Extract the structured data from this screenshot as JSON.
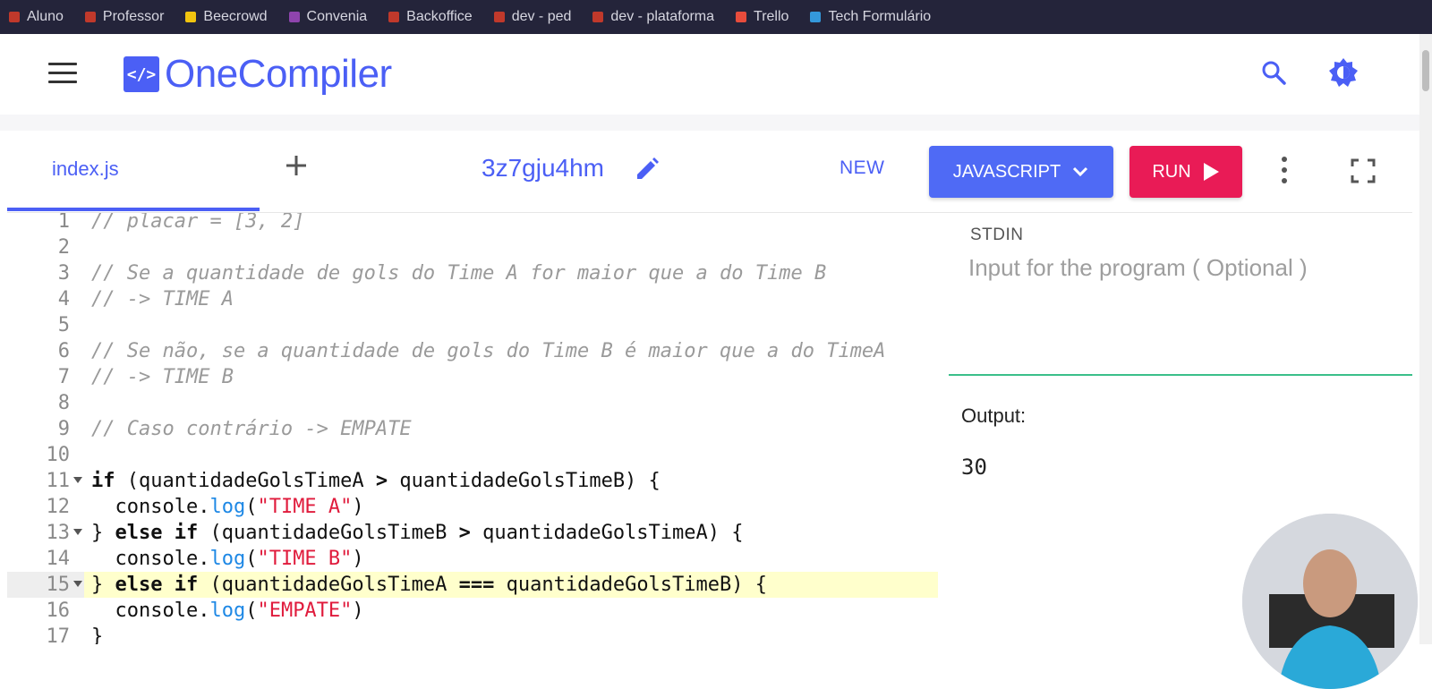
{
  "bookmarks": [
    {
      "label": "Aluno",
      "color": "#c0392b"
    },
    {
      "label": "Professor",
      "color": "#c0392b"
    },
    {
      "label": "Beecrowd",
      "color": "#f1c40f"
    },
    {
      "label": "Convenia",
      "color": "#8e44ad"
    },
    {
      "label": "Backoffice",
      "color": "#c0392b"
    },
    {
      "label": "dev - ped",
      "color": "#c0392b"
    },
    {
      "label": "dev - plataforma",
      "color": "#c0392b"
    },
    {
      "label": "Trello",
      "color": "#e74c3c"
    },
    {
      "label": "Tech Formulário",
      "color": "#3498db"
    }
  ],
  "header": {
    "logo_badge": "</>",
    "logo_text": "OneCompiler",
    "search_icon": "search-icon",
    "theme_icon": "theme-toggle-icon"
  },
  "toolbar": {
    "tab_file": "index.js",
    "title_id": "3z7gju4hm",
    "new_label": "NEW",
    "language_label": "JAVASCRIPT",
    "run_label": "RUN"
  },
  "colors": {
    "accent": "#4b5ff5",
    "run": "#e91b56",
    "divider": "#3bbf8a"
  },
  "editor": {
    "highlighted_line": 15,
    "lines": [
      {
        "n": "1",
        "fold": false,
        "tokens": [
          {
            "t": "// placar = [3, 2]",
            "c": "cm"
          }
        ]
      },
      {
        "n": "2",
        "fold": false,
        "tokens": []
      },
      {
        "n": "3",
        "fold": false,
        "tokens": [
          {
            "t": "// Se a quantidade de gols do Time A for maior que a do Time B",
            "c": "cm"
          }
        ]
      },
      {
        "n": "4",
        "fold": false,
        "tokens": [
          {
            "t": "// -> TIME A",
            "c": "cm"
          }
        ]
      },
      {
        "n": "5",
        "fold": false,
        "tokens": []
      },
      {
        "n": "6",
        "fold": false,
        "tokens": [
          {
            "t": "// Se não, se a quantidade de gols do Time B é maior que a do TimeA",
            "c": "cm"
          }
        ]
      },
      {
        "n": "7",
        "fold": false,
        "tokens": [
          {
            "t": "// -> TIME B",
            "c": "cm"
          }
        ]
      },
      {
        "n": "8",
        "fold": false,
        "tokens": []
      },
      {
        "n": "9",
        "fold": false,
        "tokens": [
          {
            "t": "// Caso contrário -> EMPATE",
            "c": "cm"
          }
        ]
      },
      {
        "n": "10",
        "fold": false,
        "tokens": []
      },
      {
        "n": "11",
        "fold": true,
        "tokens": [
          {
            "t": "if",
            "c": "kw"
          },
          {
            "t": " (quantidadeGolsTimeA ",
            "c": ""
          },
          {
            "t": ">",
            "c": "kw"
          },
          {
            "t": " quantidadeGolsTimeB) {",
            "c": ""
          }
        ]
      },
      {
        "n": "12",
        "fold": false,
        "tokens": [
          {
            "t": "  console.",
            "c": ""
          },
          {
            "t": "log",
            "c": "fn"
          },
          {
            "t": "(",
            "c": ""
          },
          {
            "t": "\"TIME A\"",
            "c": "str"
          },
          {
            "t": ")",
            "c": ""
          }
        ]
      },
      {
        "n": "13",
        "fold": true,
        "tokens": [
          {
            "t": "} ",
            "c": ""
          },
          {
            "t": "else if",
            "c": "kw"
          },
          {
            "t": " (quantidadeGolsTimeB ",
            "c": ""
          },
          {
            "t": ">",
            "c": "kw"
          },
          {
            "t": " quantidadeGolsTimeA) {",
            "c": ""
          }
        ]
      },
      {
        "n": "14",
        "fold": false,
        "tokens": [
          {
            "t": "  console.",
            "c": ""
          },
          {
            "t": "log",
            "c": "fn"
          },
          {
            "t": "(",
            "c": ""
          },
          {
            "t": "\"TIME B\"",
            "c": "str"
          },
          {
            "t": ")",
            "c": ""
          }
        ]
      },
      {
        "n": "15",
        "fold": true,
        "tokens": [
          {
            "t": "} ",
            "c": ""
          },
          {
            "t": "else if",
            "c": "kw"
          },
          {
            "t": " (quantidadeGolsTimeA ",
            "c": ""
          },
          {
            "t": "===",
            "c": "kw"
          },
          {
            "t": " quantidadeGolsTimeB) {",
            "c": ""
          }
        ]
      },
      {
        "n": "16",
        "fold": false,
        "tokens": [
          {
            "t": "  console.",
            "c": ""
          },
          {
            "t": "log",
            "c": "fn"
          },
          {
            "t": "(",
            "c": ""
          },
          {
            "t": "\"EMPATE\"",
            "c": "str"
          },
          {
            "t": ")",
            "c": ""
          }
        ]
      },
      {
        "n": "17",
        "fold": false,
        "tokens": [
          {
            "t": "}",
            "c": ""
          }
        ]
      }
    ]
  },
  "stdin": {
    "label": "STDIN",
    "placeholder": "Input for the program ( Optional )"
  },
  "output": {
    "label": "Output:",
    "value": "30"
  }
}
